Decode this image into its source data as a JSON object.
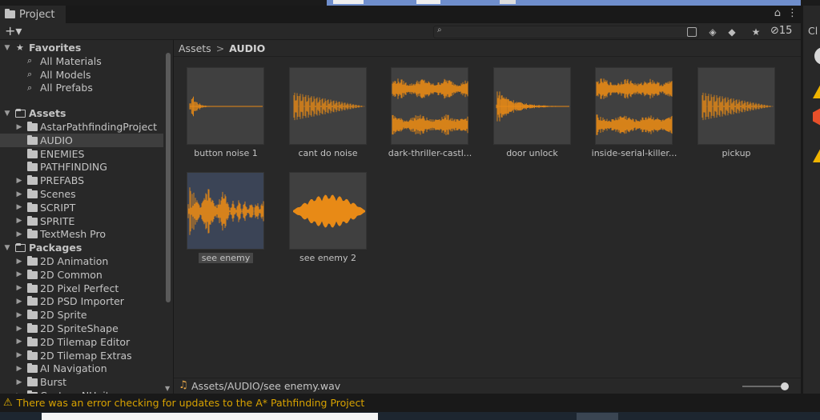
{
  "window": {
    "tab_title": "Project",
    "menu_glyph": "⋮",
    "lock_glyph": "⌂",
    "add_glyph": "+▾"
  },
  "toolbar": {
    "search_placeholder": "",
    "hidden_count": "15",
    "icons": [
      "search-icon",
      "save-search-icon",
      "filter-by-type-icon",
      "filter-by-label-icon",
      "favorite-star-icon",
      "visibility-icon"
    ]
  },
  "tree": {
    "favorites_label": "Favorites",
    "favorites": [
      "All Materials",
      "All Models",
      "All Prefabs"
    ],
    "assets_label": "Assets",
    "assets": [
      {
        "label": "AstarPathfindingProject",
        "expandable": true
      },
      {
        "label": "AUDIO",
        "expandable": false,
        "selected": true
      },
      {
        "label": "ENEMIES",
        "expandable": false
      },
      {
        "label": "PATHFINDING",
        "expandable": false
      },
      {
        "label": "PREFABS",
        "expandable": true
      },
      {
        "label": "Scenes",
        "expandable": true
      },
      {
        "label": "SCRIPT",
        "expandable": true
      },
      {
        "label": "SPRITE",
        "expandable": true
      },
      {
        "label": "TextMesh Pro",
        "expandable": true
      }
    ],
    "packages_label": "Packages",
    "packages": [
      "2D Animation",
      "2D Common",
      "2D Pixel Perfect",
      "2D PSD Importer",
      "2D Sprite",
      "2D SpriteShape",
      "2D Tilemap Editor",
      "2D Tilemap Extras",
      "AI Navigation",
      "Burst",
      "Custom NUnit"
    ]
  },
  "breadcrumb": {
    "root": "Assets",
    "separator": ">",
    "current": "AUDIO"
  },
  "assets_grid": [
    {
      "name": "button noise 1",
      "wave": "decay-fast"
    },
    {
      "name": "cant do noise",
      "wave": "cone"
    },
    {
      "name": "dark-thriller-castl...",
      "wave": "stereo-dense"
    },
    {
      "name": "door unlock",
      "wave": "decay-long"
    },
    {
      "name": "inside-serial-killer...",
      "wave": "stereo-dense"
    },
    {
      "name": "pickup",
      "wave": "cone"
    },
    {
      "name": "see enemy",
      "wave": "bursty",
      "selected": true
    },
    {
      "name": "see enemy 2",
      "wave": "blob"
    }
  ],
  "pathbar": {
    "path": "Assets/AUDIO/see enemy.wav",
    "icon": "audio-clip-icon",
    "zoom": 1.0
  },
  "status": {
    "message": "There was an error checking for updates to the A* Pathfinding Project",
    "icon": "warning-icon"
  },
  "right_panel": {
    "tab_label": "Cl"
  },
  "colors": {
    "waveform": "#e88a16",
    "warning": "#d8a200",
    "selection": "#3e3e3e"
  }
}
